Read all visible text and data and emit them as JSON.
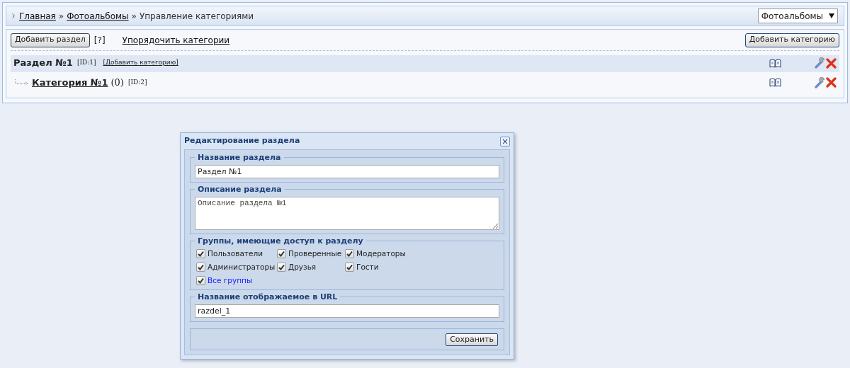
{
  "breadcrumb": [
    {
      "label": "Главная",
      "kind": "link"
    },
    {
      "label": "»",
      "kind": "sep"
    },
    {
      "label": "Фотоальбомы",
      "kind": "link"
    },
    {
      "label": "»",
      "kind": "sep"
    },
    {
      "label": "Управление категориями",
      "kind": "text"
    }
  ],
  "module_select": {
    "value": "Фотоальбомы"
  },
  "toolbar": {
    "add_section": "Добавить раздел",
    "help": "[?]",
    "sort_link": "Упорядочить категории",
    "add_category": "Добавить категорию"
  },
  "sections": [
    {
      "kind": "section",
      "title": "Раздел №1",
      "id": "[ID:1]",
      "add_link": "[Добавить категорию]"
    },
    {
      "kind": "category",
      "title": "Категория №1",
      "count": "(0)",
      "id": "[ID:2]"
    }
  ],
  "dialog": {
    "title": "Редактирование раздела",
    "close": "×",
    "name_legend": "Название раздела",
    "name_value": "Раздел №1",
    "desc_legend": "Описание раздела",
    "desc_value": "Описание раздела №1",
    "groups_legend": "Группы, имеющие доступ к разделу",
    "groups": [
      {
        "label": "Пользователи",
        "checked": true,
        "kind": "group"
      },
      {
        "label": "Проверенные",
        "checked": true,
        "kind": "group"
      },
      {
        "label": "Модераторы",
        "checked": true,
        "kind": "group"
      },
      {
        "label": "Администраторы",
        "checked": true,
        "kind": "group"
      },
      {
        "label": "Друзья",
        "checked": true,
        "kind": "group"
      },
      {
        "label": "Гости",
        "checked": true,
        "kind": "group"
      },
      {
        "label": "Все группы",
        "checked": true,
        "kind": "all"
      }
    ],
    "url_legend": "Название отображаемое в URL",
    "url_value": "razdel_1",
    "save": "Сохранить"
  }
}
